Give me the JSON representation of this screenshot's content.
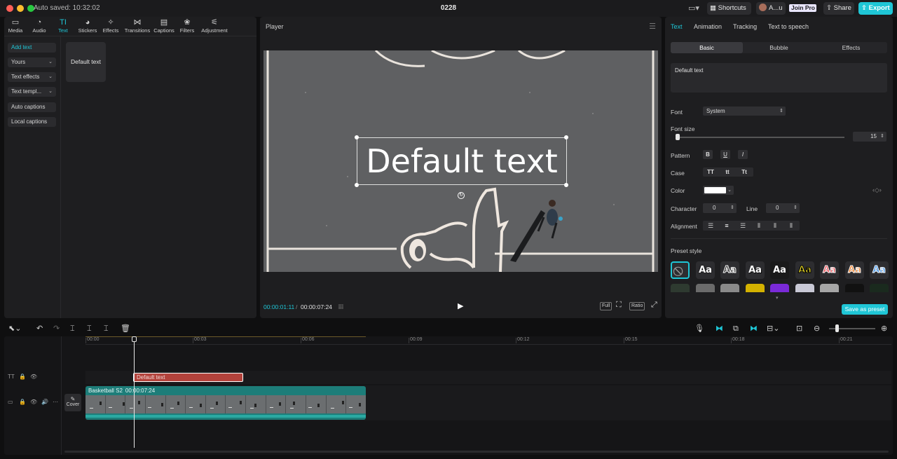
{
  "titlebar": {
    "autosave": "Auto saved: 10:32:02",
    "project_title": "0228",
    "shortcuts": "Shortcuts",
    "user": "A...u",
    "join_pro": "Join Pro",
    "share": "Share",
    "export": "Export"
  },
  "toolbar": {
    "items": [
      {
        "label": "Media",
        "icon": "▭"
      },
      {
        "label": "Audio",
        "icon": "◔"
      },
      {
        "label": "Text",
        "icon": "TI"
      },
      {
        "label": "Stickers",
        "icon": "◕"
      },
      {
        "label": "Effects",
        "icon": "✧"
      },
      {
        "label": "Transitions",
        "icon": "⋈"
      },
      {
        "label": "Captions",
        "icon": "▤"
      },
      {
        "label": "Filters",
        "icon": "❀"
      },
      {
        "label": "Adjustment",
        "icon": "⚟"
      }
    ]
  },
  "sidebar": {
    "items": [
      {
        "label": "Add text"
      },
      {
        "label": "Yours"
      },
      {
        "label": "Text effects"
      },
      {
        "label": "Text templ..."
      },
      {
        "label": "Auto captions"
      },
      {
        "label": "Local captions"
      }
    ]
  },
  "text_card": "Default text",
  "player": {
    "title": "Player",
    "overlay_text": "Default text",
    "current_time": "00:00:01:11",
    "separator": "/",
    "total_time": "00:00:07:24",
    "full_label": "Full",
    "ratio_label": "Ratio"
  },
  "right_panel": {
    "tabs": [
      "Text",
      "Animation",
      "Tracking",
      "Text to speech"
    ],
    "subtabs": [
      "Basic",
      "Bubble",
      "Effects"
    ],
    "text_value": "Default text",
    "font_label": "Font",
    "font_value": "System",
    "font_size_label": "Font size",
    "font_size_value": "15",
    "pattern_label": "Pattern",
    "pattern_buttons": [
      "B",
      "U",
      "I"
    ],
    "case_label": "Case",
    "case_buttons": [
      "TT",
      "tt",
      "Tt"
    ],
    "color_label": "Color",
    "text_color": "#ffffff",
    "character_label": "Character",
    "character_value": "0",
    "line_label": "Line",
    "line_value": "0",
    "alignment_label": "Alignment",
    "preset_style_label": "Preset style",
    "preset_sample": "Aa",
    "save_as_preset": "Save as preset"
  },
  "timeline": {
    "ruler_labels": [
      "00:00",
      "00:03",
      "00:06",
      "00:09",
      "00:12",
      "00:15",
      "00:18",
      "00:21"
    ],
    "text_clip_label": "Default text",
    "video_clip_name": "Basketball S2",
    "video_clip_duration": "00:00:07:24",
    "cover_label": "Cover"
  },
  "colors": {
    "accent": "#1fc6d6",
    "text_clip": "#b3423b",
    "video_clip": "#1d7d79"
  }
}
